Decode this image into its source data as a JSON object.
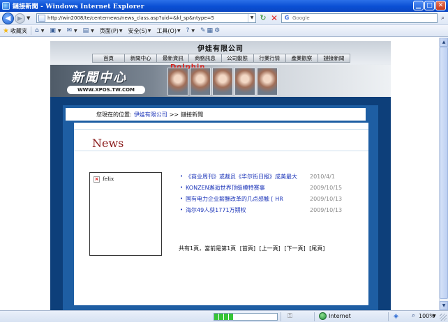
{
  "window": {
    "title": "鏈接新聞 - Windows Internet Explorer",
    "min_label": "▁",
    "max_label": "□",
    "close_label": "✕"
  },
  "addressbar": {
    "url": "http://win2008/te/centernews/news_class.asp?uid=&kl_sp&ntype=5",
    "search_placeholder": "Google"
  },
  "commandbar": {
    "favorites_label": "收藏夹",
    "page_label": "页面(P)",
    "safety_label": "安全(S)",
    "tools_label": "工具(O)"
  },
  "site": {
    "company_name": "伊娃有限公司",
    "nav": [
      "首頁",
      "新聞中心",
      "最新資訊",
      "商務訊息",
      "公司動態",
      "行業行情",
      "產業觀察",
      "鏈接新聞"
    ],
    "banner_logo": "新聞中心",
    "banner_url": "WWW.XPOS.TW.COM",
    "banner_brand": "Dolphin",
    "breadcrumb": {
      "prefix": "您現在的位置:",
      "link": "伊娃有限公司",
      "sep": ">>",
      "current": "鏈接新聞"
    },
    "page_title": "News",
    "image_alt": "felix",
    "news": [
      {
        "title": "《商业周刊》或裁员《华尔街日报》成美最大",
        "date": "2010/4/1"
      },
      {
        "title": "KONZEN邂逅世界顶级模特赛事",
        "date": "2009/10/15"
      },
      {
        "title": "国有电力企业薪酬改革的几点感触 [ HR",
        "date": "2009/10/13"
      },
      {
        "title": "海尔49人获1771万期权",
        "date": "2009/10/13"
      }
    ],
    "pager": {
      "summary": "共有1頁，當前是第1頁",
      "first": "[首頁]",
      "prev": "[上一頁]",
      "next": "[下一頁]",
      "last": "[尾頁]"
    }
  },
  "statusbar": {
    "zone": "Internet",
    "zoom": "100%",
    "progress": 0.3
  },
  "icons": {
    "back": "back-arrow-icon",
    "forward": "forward-arrow-icon",
    "refresh": "refresh-icon",
    "stop": "stop-icon",
    "search": "magnifier-icon",
    "favorites": "star-icon",
    "home": "home-icon",
    "feeds": "rss-icon",
    "mail": "mail-icon",
    "print": "printer-icon",
    "help": "help-icon",
    "zone": "globe-icon",
    "zoom": "zoom-icon"
  },
  "colors": {
    "link": "#1a33b8",
    "title": "#8a1a1a",
    "frame": "#0d3f7a"
  }
}
